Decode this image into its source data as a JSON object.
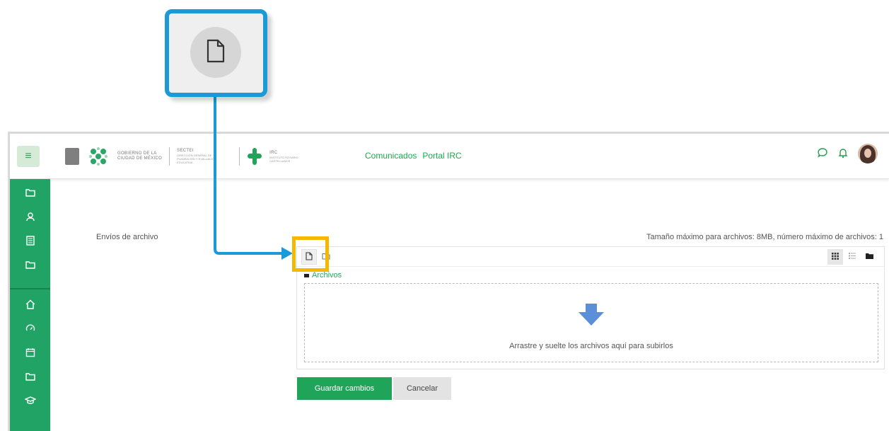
{
  "header": {
    "logo_gov_line1": "GOBIERNO DE LA",
    "logo_gov_line2": "CIUDAD DE MÉXICO",
    "logo_sectei": "SECTEI",
    "logo_sectei_sub": "DIRECCIÓN GENERAL DE PLANEACIÓN Y EVALUACIÓN EDUCATIVA",
    "logo_irc": "IRC",
    "logo_irc_sub": "INSTITUTO ROSARIO CASTELLANOS",
    "nav": [
      "Comunicados",
      "Portal IRC"
    ],
    "icons": [
      "chat-bubble-icon",
      "bell-icon"
    ]
  },
  "sidebar": {
    "items": [
      "folder-icon",
      "users-icon",
      "book-icon",
      "folder-icon",
      "home-icon",
      "dashboard-icon",
      "calendar-icon",
      "folder-icon",
      "graduation-cap-icon"
    ]
  },
  "form": {
    "field_label": "Envíos de archivo",
    "limits": "Tamaño máximo para archivos: 8MB, número máximo de archivos: 1",
    "files_label": "Archivos",
    "drop_text": "Arrastre y suelte los archivos aquí para subirlos",
    "save_label": "Guardar cambios",
    "cancel_label": "Cancelar"
  },
  "colors": {
    "brand_green": "#1fa45a",
    "callout_blue": "#1a9ad6",
    "highlight_yellow": "#f5b800",
    "arrow_blue": "#5b8fd8"
  }
}
